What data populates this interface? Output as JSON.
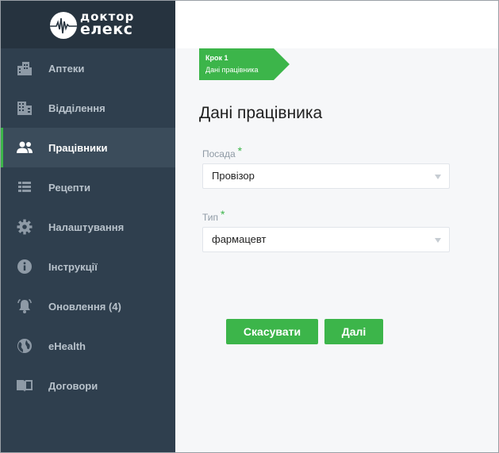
{
  "brand": {
    "line1": "доктор",
    "line2": "елекс"
  },
  "sidebar": {
    "items": [
      {
        "label": "Аптеки",
        "icon": "building-icon",
        "active": false
      },
      {
        "label": "Відділення",
        "icon": "office-icon",
        "active": false
      },
      {
        "label": "Працівники",
        "icon": "people-icon",
        "active": true
      },
      {
        "label": "Рецепти",
        "icon": "list-icon",
        "active": false
      },
      {
        "label": "Налаштування",
        "icon": "gear-icon",
        "active": false
      },
      {
        "label": "Інструкції",
        "icon": "info-icon",
        "active": false
      },
      {
        "label": "Оновлення (4)",
        "icon": "bell-icon",
        "active": false
      },
      {
        "label": "eHealth",
        "icon": "globe-icon",
        "active": false
      },
      {
        "label": "Договори",
        "icon": "book-icon",
        "active": false
      }
    ]
  },
  "step": {
    "number": "Крок 1",
    "title": "Дані працівника"
  },
  "main": {
    "title": "Дані працівника",
    "fields": [
      {
        "label": "Посада",
        "required": "*",
        "value": "Провізор"
      },
      {
        "label": "Тип",
        "required": "*",
        "value": "фармацевт"
      }
    ],
    "cancel_label": "Скасувати",
    "next_label": "Далі"
  },
  "colors": {
    "accent": "#3cb54a",
    "sidebar": "#2f3f4e",
    "sidebar_active": "#3b4c5b",
    "logo_bar": "#26333f"
  }
}
